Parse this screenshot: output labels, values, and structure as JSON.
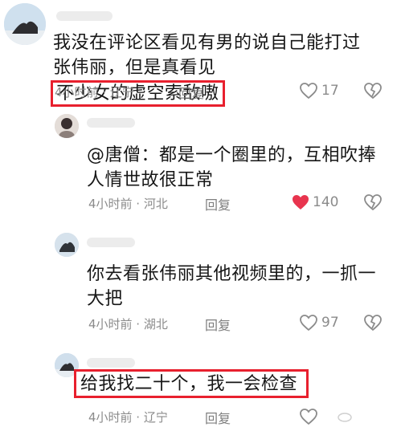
{
  "comments": [
    {
      "text_plain": "我没在评论区看见有男的说自己能打过张伟丽，但是真看见",
      "text_highlight": "不少女的虚空索敌嗷",
      "meta": "4小时前 · 辽宁",
      "reply": "回复",
      "likes": "17"
    },
    {
      "text": "@唐僧：都是一个圈里的，互相吹捧人情世故很正常",
      "meta": "4小时前 · 河北",
      "reply": "回复",
      "likes": "140"
    },
    {
      "text": "你去看张伟丽其他视频里的，一抓一大把",
      "meta": "4小时前 · 湖北",
      "reply": "回复",
      "likes": "97"
    },
    {
      "text": "给我找二十个，我一会检查",
      "meta": "4小时前 · 辽宁",
      "reply": "回复"
    }
  ],
  "icons": {
    "like": "heart-outline-icon",
    "liked": "heart-filled-icon",
    "dislike": "broken-heart-icon"
  },
  "colors": {
    "highlight_border": "#e8202e",
    "liked_heart": "#e8344e"
  }
}
